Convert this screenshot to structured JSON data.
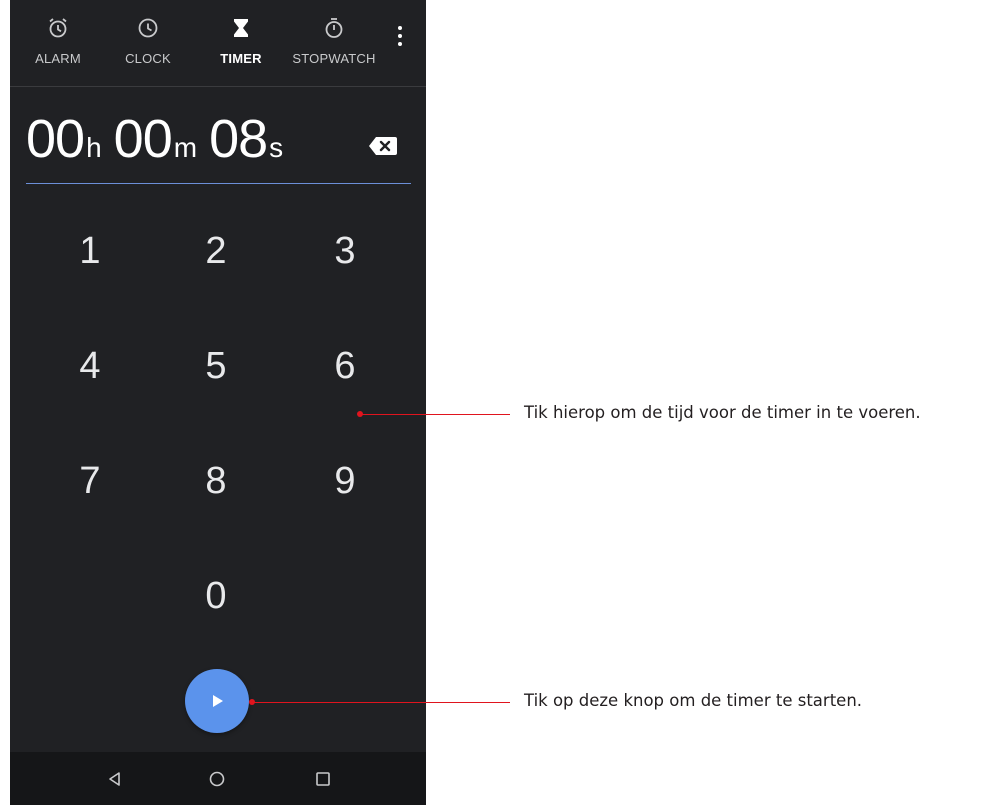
{
  "tabs": [
    {
      "label": "ALARM",
      "icon": "alarm-icon"
    },
    {
      "label": "CLOCK",
      "icon": "clock-icon"
    },
    {
      "label": "TIMER",
      "icon": "hourglass-icon",
      "active": true
    },
    {
      "label": "STOPWATCH",
      "icon": "stopwatch-icon"
    }
  ],
  "timer": {
    "hours": "00",
    "hours_unit": "h",
    "minutes": "00",
    "minutes_unit": "m",
    "seconds": "08",
    "seconds_unit": "s"
  },
  "keypad": [
    "1",
    "2",
    "3",
    "4",
    "5",
    "6",
    "7",
    "8",
    "9",
    "0"
  ],
  "annotations": {
    "keypad_hint": "Tik hierop om de tijd voor de timer in te voeren.",
    "start_hint": "Tik op deze knop om de timer te starten."
  },
  "colors": {
    "background": "#202124",
    "accent": "#5b93ec",
    "callout": "#e0141e"
  }
}
